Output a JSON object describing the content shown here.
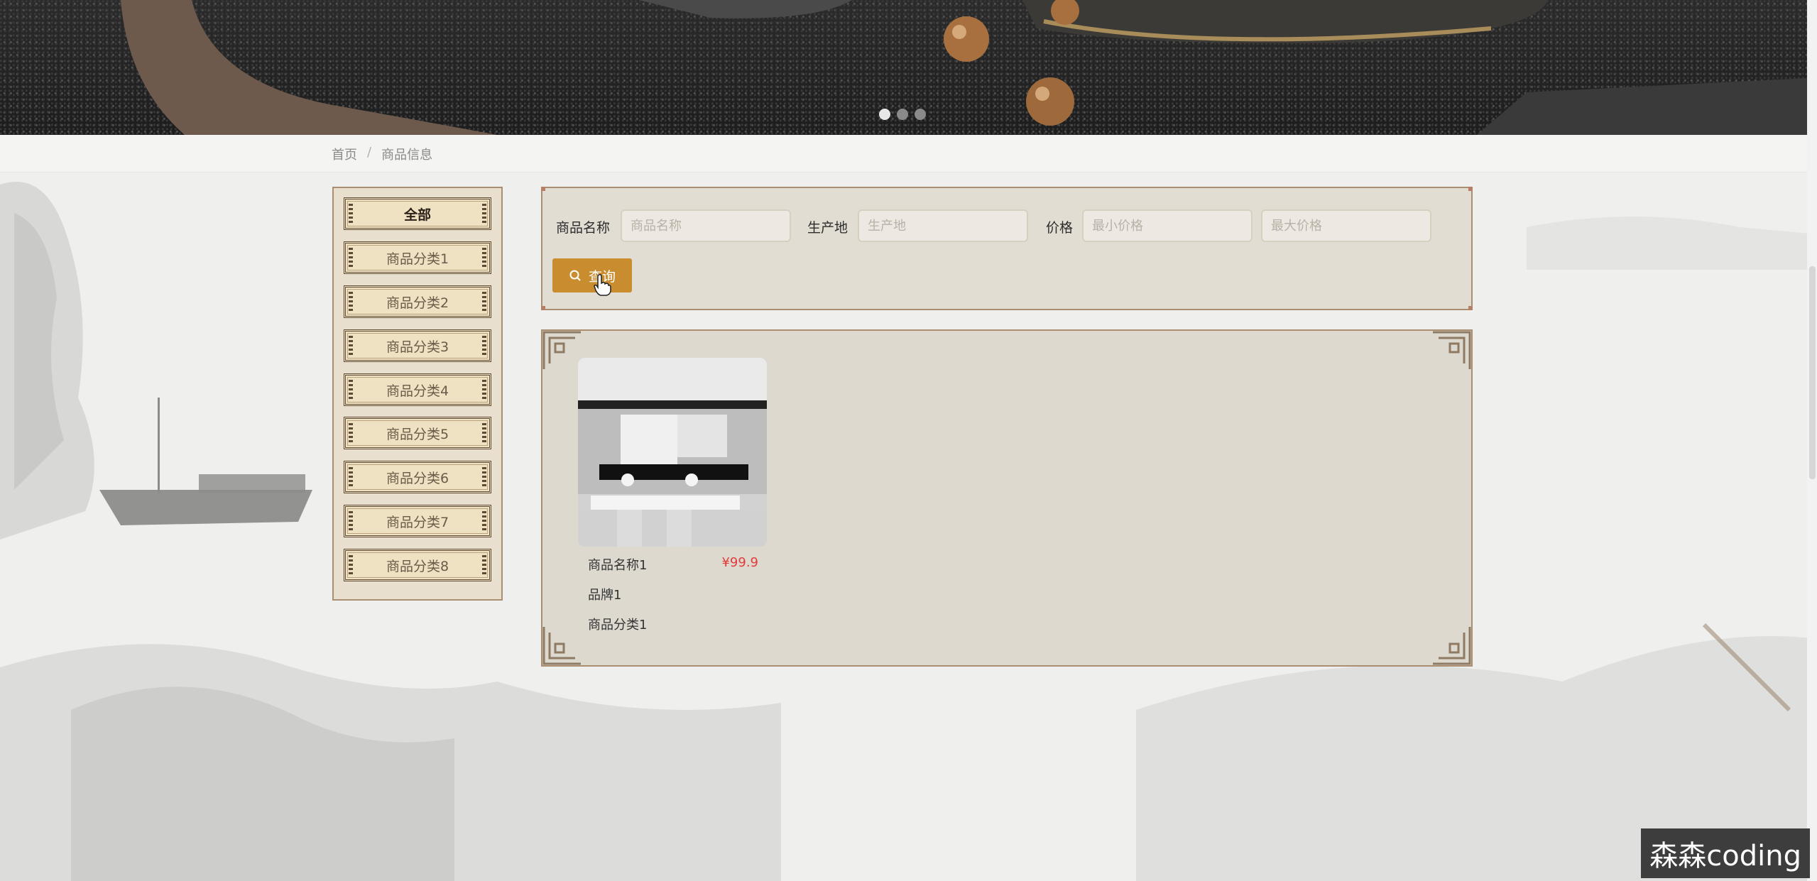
{
  "banner": {
    "carousel_dots": 3,
    "active_dot": 0
  },
  "breadcrumb": {
    "home": "首页",
    "separator": "/",
    "current": "商品信息"
  },
  "categories": [
    {
      "label": "全部",
      "active": true
    },
    {
      "label": "商品分类1"
    },
    {
      "label": "商品分类2"
    },
    {
      "label": "商品分类3"
    },
    {
      "label": "商品分类4"
    },
    {
      "label": "商品分类5"
    },
    {
      "label": "商品分类6"
    },
    {
      "label": "商品分类7"
    },
    {
      "label": "商品分类8"
    }
  ],
  "search": {
    "name_label": "商品名称",
    "name_placeholder": "商品名称",
    "origin_label": "生产地",
    "origin_placeholder": "生产地",
    "price_label": "价格",
    "min_price_placeholder": "最小价格",
    "max_price_placeholder": "最大价格",
    "button_label": "查询",
    "button_icon": "search-icon"
  },
  "products": [
    {
      "name": "商品名称1",
      "price": "¥99.9",
      "brand": "品牌1",
      "category": "商品分类1"
    }
  ],
  "watermark": "森森coding",
  "colors": {
    "accent": "#c98d2f",
    "price": "#e23b3b",
    "panel_border": "#a98e72"
  }
}
